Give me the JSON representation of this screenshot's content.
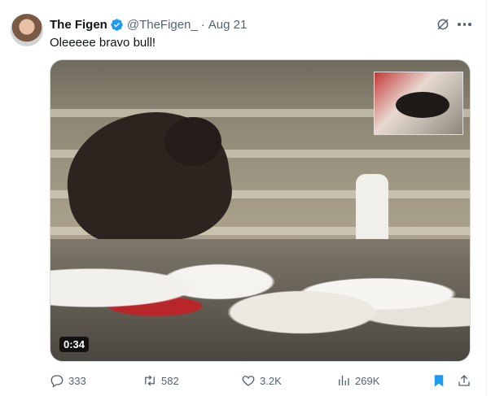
{
  "tweet": {
    "author_name": "The Figen",
    "handle": "@TheFigen_",
    "separator": "·",
    "date": "Aug 21",
    "text": "Oleeeee bravo bull!",
    "video_duration": "0:34"
  },
  "stats": {
    "replies": "333",
    "retweets": "582",
    "likes": "3.2K",
    "views": "269K"
  },
  "colors": {
    "verified": "#1d9bf0",
    "secondary_text": "#536471",
    "bookmark_active": "#1d9bf0"
  },
  "icons": [
    "verified-badge-icon",
    "grok-icon",
    "more-icon",
    "reply-icon",
    "retweet-icon",
    "like-icon",
    "views-icon",
    "bookmark-icon",
    "share-icon"
  ]
}
